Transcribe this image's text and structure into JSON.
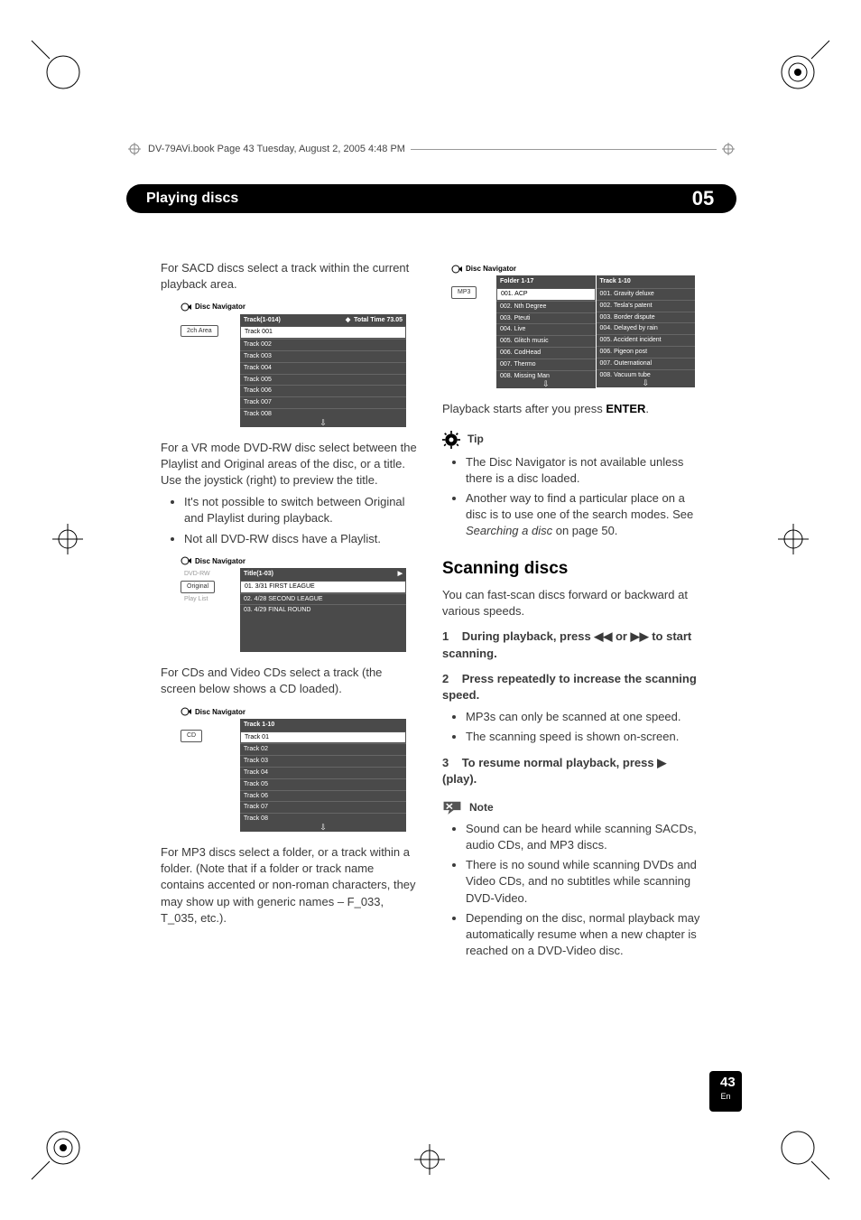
{
  "print_header": "DV-79AVi.book  Page 43  Tuesday, August 2, 2005  4:48 PM",
  "chapter": {
    "title": "Playing discs",
    "number": "05"
  },
  "left": {
    "p1": "For SACD discs select a track within the current playback area.",
    "panel1": {
      "label": "Disc Navigator",
      "side_sel": "2ch Area",
      "head_left": "Track(1-014)",
      "head_mid_glyph": "◆",
      "head_right": "Total Time   73.05",
      "rows": [
        "Track 001",
        "Track 002",
        "Track 003",
        "Track 004",
        "Track 005",
        "Track 006",
        "Track 007",
        "Track 008"
      ]
    },
    "p2": "For a VR mode DVD-RW disc select between the Playlist and Original areas of the disc, or a title. Use the joystick (right) to preview the title.",
    "b1": "It's not possible to switch between Original and Playlist during playback.",
    "b2": "Not all DVD-RW discs have a Playlist.",
    "panel2": {
      "label": "Disc Navigator",
      "side": [
        "DVD-RW",
        "Original",
        "Play List"
      ],
      "head": "Title(1-03)",
      "rows": [
        "01. 3/31 FIRST LEAGUE",
        "02. 4/28 SECOND LEAGUE",
        "03. 4/29 FINAL ROUND"
      ]
    },
    "p3": "For CDs and Video CDs select a track (the screen below shows a CD loaded).",
    "panel3": {
      "label": "Disc Navigator",
      "side_sel": "CD",
      "head": "Track 1-10",
      "rows": [
        "Track 01",
        "Track 02",
        "Track 03",
        "Track 04",
        "Track 05",
        "Track 06",
        "Track 07",
        "Track 08"
      ]
    },
    "p4": "For MP3 discs select a folder, or a track within a folder. (Note that if a folder or track name contains accented or non-roman characters, they may show up with generic names – F_033, T_035, etc.)."
  },
  "right": {
    "panel4": {
      "label": "Disc Navigator",
      "side_sel": "MP3",
      "head1": "Folder 1-17",
      "head2": "Track 1-10",
      "col1": [
        "001. ACP",
        "002. Nth Degree",
        "003. Pteuti",
        "004. Live",
        "005. Glitch music",
        "006. CodHead",
        "007. Thermo",
        "008. Missing Man"
      ],
      "col2": [
        "001. Gravity deluxe",
        "002. Tesla's patent",
        "003. Border dispute",
        "004. Delayed by rain",
        "005. Accident incident",
        "006. Pigeon post",
        "007. Outernational",
        "008. Vacuum tube"
      ]
    },
    "playback": {
      "pre": "Playback starts after you press ",
      "b": "ENTER",
      "post": "."
    },
    "tip_label": "Tip",
    "tip1": "The Disc Navigator is not available unless there is a disc loaded.",
    "tip2_pre": "Another way to find a particular place on a disc is to use one of the search modes. See ",
    "tip2_i": "Searching a disc",
    "tip2_post": " on page 50.",
    "section": "Scanning discs",
    "sec_p": "You can fast-scan discs forward or backward at various speeds.",
    "step1_num": "1",
    "step1_pre": "During playback, press ",
    "step1_sym1": "◀◀",
    "step1_mid": " or ",
    "step1_sym2": "▶▶",
    "step1_post": " to start scanning.",
    "step2_num": "2",
    "step2": "Press repeatedly to increase the scanning speed.",
    "step2_b1": "MP3s can only be scanned at one speed.",
    "step2_b2": "The scanning speed is shown on-screen.",
    "step3_num": "3",
    "step3_pre": "To resume normal playback, press ",
    "step3_sym": "▶",
    "step3_post": " (play).",
    "note_label": "Note",
    "note1": "Sound can be heard while scanning SACDs, audio CDs, and MP3 discs.",
    "note2": "There is no sound while scanning DVDs and Video CDs, and no subtitles while scanning DVD-Video.",
    "note3": "Depending on the disc, normal playback may automatically resume when a new chapter is reached on a DVD-Video disc."
  },
  "footer": {
    "page": "43",
    "lang": "En"
  }
}
